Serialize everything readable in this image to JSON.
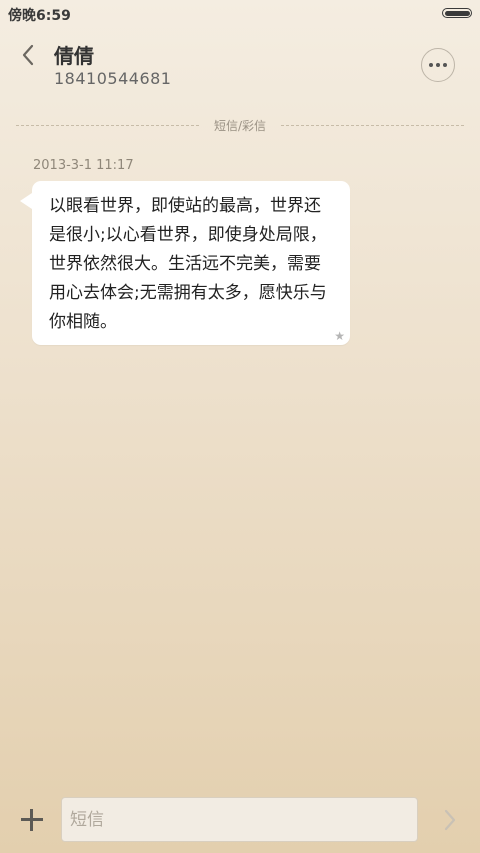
{
  "status_bar": {
    "time": "傍晚6:59",
    "battery_level": 1.0
  },
  "header": {
    "contact_name": "倩倩",
    "contact_number": "18410544681",
    "icons": {
      "back": "chevron-left-icon",
      "more": "more-horizontal-icon"
    }
  },
  "divider": {
    "label": "短信/彩信"
  },
  "messages": [
    {
      "time": "2013-3-1 11:17",
      "text": "以眼看世界，即使站的最高，世界还是很小;以心看世界，即使身处局限，世界依然很大。生活远不完美，需要用心去体会;无需拥有太多，愿快乐与你相随。",
      "starred": true,
      "star_glyph": "★"
    }
  ],
  "composer": {
    "placeholder": "短信",
    "value": "",
    "icons": {
      "add": "plus-icon",
      "send": "chevron-right-icon"
    }
  },
  "colors": {
    "background_top": "#f4ede1",
    "background_bottom": "#e3cfae",
    "bubble": "#ffffff",
    "text_primary": "#333333"
  }
}
